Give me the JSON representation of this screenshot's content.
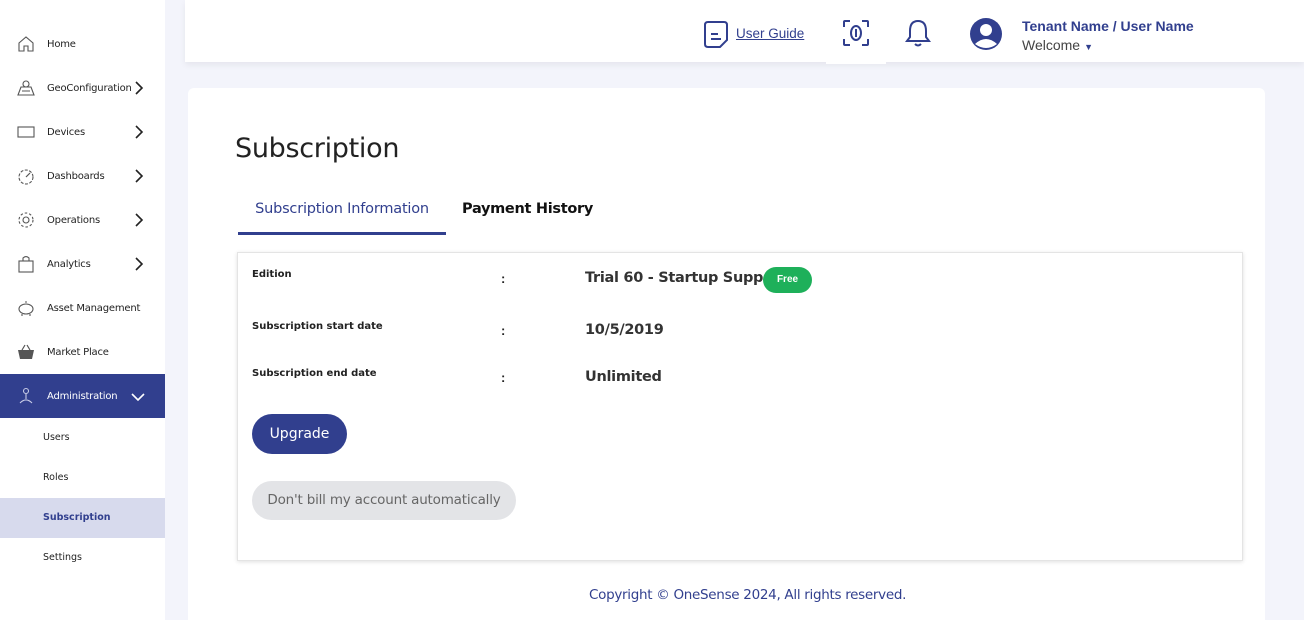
{
  "sidebar": {
    "items": [
      {
        "label": "Home",
        "icon": "home-icon"
      },
      {
        "label": "GeoConfiguration",
        "icon": "map-icon"
      },
      {
        "label": "Devices",
        "icon": "monitor-icon"
      },
      {
        "label": "Dashboards",
        "icon": "gauge-icon"
      },
      {
        "label": "Operations",
        "icon": "gear-icon"
      },
      {
        "label": "Analytics",
        "icon": "bag-icon"
      },
      {
        "label": "Asset Management",
        "icon": "piggy-bank-icon"
      },
      {
        "label": "Market Place",
        "icon": "basket-icon"
      },
      {
        "label": "Administration",
        "icon": "admin-icon"
      }
    ],
    "sub_items": [
      {
        "label": "Users"
      },
      {
        "label": "Roles"
      },
      {
        "label": "Subscription"
      },
      {
        "label": "Settings"
      }
    ]
  },
  "header": {
    "user_guide": "User Guide",
    "tenant": "Tenant Name / User Name",
    "welcome": "Welcome"
  },
  "main": {
    "title": "Subscription",
    "tabs": [
      {
        "label": "Subscription Information"
      },
      {
        "label": "Payment History"
      }
    ],
    "rows": [
      {
        "label": "Edition",
        "colon": ":",
        "value": "Trial 60 - Startup Support"
      },
      {
        "label": "Subscription start date",
        "colon": ":",
        "value": "10/5/2019"
      },
      {
        "label": "Subscription end date",
        "colon": ":",
        "value": "Unlimited"
      }
    ],
    "badge": "Free",
    "upgrade_label": "Upgrade",
    "no_bill_label": "Don't bill my account automatically"
  },
  "footer": "Copyright © OneSense 2024, All rights reserved.",
  "colors": {
    "primary": "#313f8e",
    "badge_green": "#1eb05a",
    "active_sub_bg": "#d7daed",
    "page_bg": "#f3f4fb"
  }
}
